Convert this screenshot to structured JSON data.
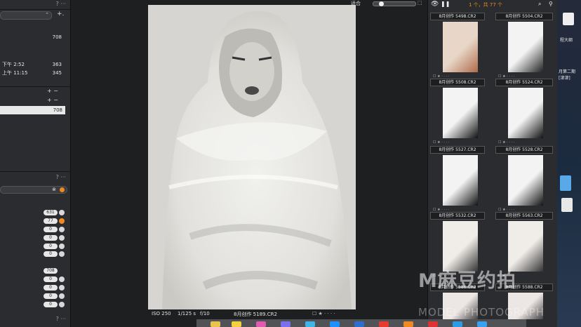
{
  "left": {
    "help_glyph": "?",
    "more_glyph": "···",
    "add_glyph": "+.",
    "top_count": "708",
    "entries": [
      {
        "label": "下午 2:52",
        "count": "363"
      },
      {
        "label": "上午 11:15",
        "count": "345"
      }
    ],
    "plus_minus": "+ −",
    "selected_count": "708",
    "filter_counts": [
      "631",
      "77",
      "0",
      "0",
      "0",
      "0"
    ],
    "bottom_counts": [
      "708",
      "0",
      "0",
      "0",
      "0",
      "0",
      "0"
    ]
  },
  "toolbar": {
    "fit_label": "适合",
    "selection_summary": "1 个，共 77 个"
  },
  "photo_info": {
    "iso": "ISO 250",
    "shutter": "1/125 s",
    "aperture": "f/10",
    "filename": "8月创作 5189.CR2"
  },
  "thumbnails": [
    {
      "name": "8月创作 5498.CR2"
    },
    {
      "name": "8月创作 5504.CR2"
    },
    {
      "name": "8月创作 5508.CR2"
    },
    {
      "name": "8月创作 5524.CR2"
    },
    {
      "name": "8月创作 5527.CR2"
    },
    {
      "name": "8月创作 5528.CR2"
    },
    {
      "name": "8月创作 5532.CR2"
    },
    {
      "name": "8月创作 5563.CR2"
    },
    {
      "name": "8月创作 5586.CR2"
    },
    {
      "name": "8月创作 5588.CR2"
    }
  ],
  "desktop": {
    "label1": "程大纲",
    "label2": "月第二期",
    "label3": "[津津]"
  },
  "watermark": {
    "main": "M麻豆约拍",
    "sub": "MODEL PHOTOGRAPH"
  },
  "colors": {
    "accent_orange": "#f08a1e",
    "panel": "#2b2c2f",
    "background": "#1b1c1e"
  }
}
